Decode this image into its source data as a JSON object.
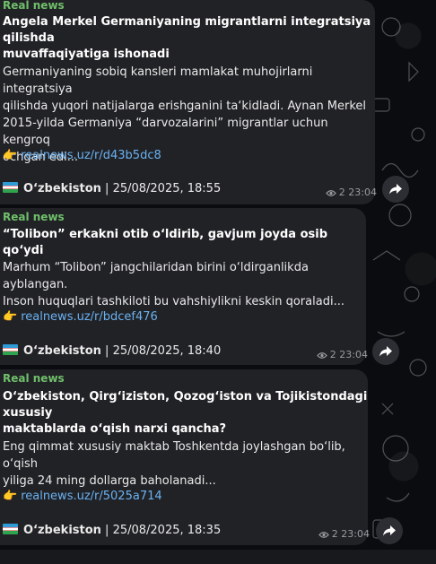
{
  "messages": [
    {
      "sender": "Real news",
      "title_line1": "Angela Merkel Germaniyaning migrantlarni integratsiya qilishda",
      "title_line2": "muvaffaqiyatiga ishonadi",
      "body_lines": [
        "Germaniyaning sobiq kansleri mamlakat muhojirlarni integratsiya",
        "qilishda yuqori natijalarga erishganini ta‘kidladi. Aynan Merkel",
        "2015-yilda Germaniya “darvozalarini” migrantlar uchun kengroq",
        "ochgan edi..."
      ],
      "link_emoji": "👉",
      "link": "realnews.uz/r/d43b5dc8",
      "footer_channel": "O‘zbekiston",
      "footer_date": " | 25/08/2025, 18:55",
      "views": "2",
      "time": "23:04"
    },
    {
      "sender": "Real news",
      "title_line1": "“Tolibon” erkakni otib o‘ldirib, gavjum joyda osib qo‘ydi",
      "title_line2": "",
      "body_lines": [
        "Marhum “Tolibon” jangchilaridan birini o‘ldirganlikda ayblangan.",
        "Inson huquqlari tashkiloti bu vahshiylikni keskin qoraladi..."
      ],
      "link_emoji": "👉",
      "link": "realnews.uz/r/bdcef476",
      "footer_channel": "O‘zbekiston",
      "footer_date": " | 25/08/2025, 18:40",
      "views": "2",
      "time": "23:04"
    },
    {
      "sender": "Real news",
      "title_line1": "O‘zbekiston, Qirg‘iziston, Qozog‘iston va Tojikistondagi xususiy",
      "title_line2": "maktablarda o‘qish narxi qancha?",
      "body_lines": [
        "Eng qimmat xususiy maktab Toshkentda joylashgan bo‘lib, o‘qish",
        "yiliga 24 ming dollarga baholanadi..."
      ],
      "link_emoji": "👉",
      "link": "realnews.uz/r/5025a714",
      "footer_channel": "O‘zbekiston",
      "footer_date": " | 25/08/2025, 18:35",
      "views": "2",
      "time": "23:04"
    }
  ],
  "colors": {
    "bubble": "#212226",
    "sender": "#6fbf6a",
    "link": "#6ab2f2",
    "meta": "#9a9ba0",
    "background": "#0b0c0f"
  },
  "icons": [
    "eye-icon",
    "share-icon",
    "pointing-hand-emoji",
    "uzbekistan-flag"
  ]
}
